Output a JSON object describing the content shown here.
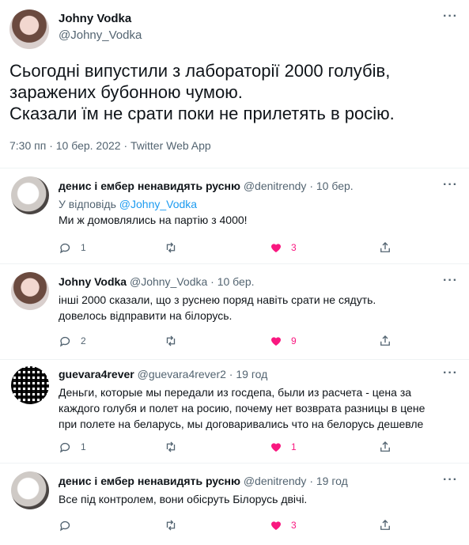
{
  "main": {
    "author_name": "Johny Vodka",
    "author_handle": "@Johny_Vodka",
    "more_icon": "ellipsis-icon",
    "text_lines": [
      "Сьогодні випустили з лабораторії 2000 голубів,",
      "заражених бубонною чумою.",
      "Сказали їм не срати поки не прилетять в росію."
    ],
    "meta": "7:30 пп · 10 бер. 2022 · Twitter Web App"
  },
  "replies": [
    {
      "name": "денис і ембер ненавидять русню",
      "handle_date": "@denitrendy · 10 бер.",
      "replying_prefix": "У відповідь ",
      "replying_to": "@Johny_Vodka",
      "lines": [
        "Ми ж домовлялись на партію з 4000!"
      ],
      "reply_count": "1",
      "retweet_count": "",
      "like_count": "3"
    },
    {
      "name": "Johny Vodka",
      "handle_date": "@Johny_Vodka · 10 бер.",
      "lines": [
        "інші 2000 сказали, що з руснею поряд навіть срати не сядуть.",
        "довелось відправити на білорусь."
      ],
      "reply_count": "2",
      "retweet_count": "",
      "like_count": "9"
    },
    {
      "name": "guevara4rever",
      "handle_date": "@guevara4rever2 · 19 год",
      "lines": [
        "Деньги, которые мы передали из госдепа, были из расчета - цена за",
        "каждого голубя и полет на росию, почему нет возврата разницы в цене",
        "при полете на беларусь, мы договаривались что на белорусь дешевле"
      ],
      "reply_count": "1",
      "retweet_count": "",
      "like_count": "1"
    },
    {
      "name": "денис і ембер ненавидять русню",
      "handle_date": "@denitrendy · 19 год",
      "lines": [
        "Все під контролем, вони обісруть Білорусь двічі."
      ],
      "reply_count": "",
      "retweet_count": "",
      "like_count": "3"
    }
  ],
  "colors": {
    "accent": "#1d9bf0",
    "like": "#f91880",
    "muted": "#536471"
  }
}
